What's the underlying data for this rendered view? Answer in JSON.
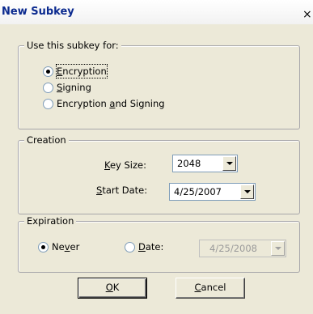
{
  "window": {
    "title": "New Subkey",
    "close_glyph": "×"
  },
  "usage_group": {
    "legend": "Use this subkey for:",
    "options": [
      {
        "pre": "",
        "mn": "E",
        "post": "ncryption",
        "checked": true
      },
      {
        "pre": "",
        "mn": "S",
        "post": "igning",
        "checked": false
      },
      {
        "pre": "Encryption ",
        "mn": "a",
        "post": "nd Signing",
        "checked": false
      }
    ]
  },
  "creation_group": {
    "legend": "Creation",
    "key_size": {
      "pre": "",
      "mn": "K",
      "post": "ey Size:",
      "value": "2048"
    },
    "start_date": {
      "pre": "",
      "mn": "S",
      "post": "tart Date:",
      "value": "4/25/2007"
    }
  },
  "expiration_group": {
    "legend": "Expiration",
    "never": {
      "pre": "Ne",
      "mn": "v",
      "post": "er",
      "checked": true
    },
    "date": {
      "pre": "",
      "mn": "D",
      "post": "ate:",
      "checked": false,
      "value": "4/25/2008"
    }
  },
  "buttons": {
    "ok": {
      "pre": "",
      "mn": "O",
      "post": "K"
    },
    "cancel": {
      "pre": "",
      "mn": "C",
      "post": "ancel"
    }
  }
}
